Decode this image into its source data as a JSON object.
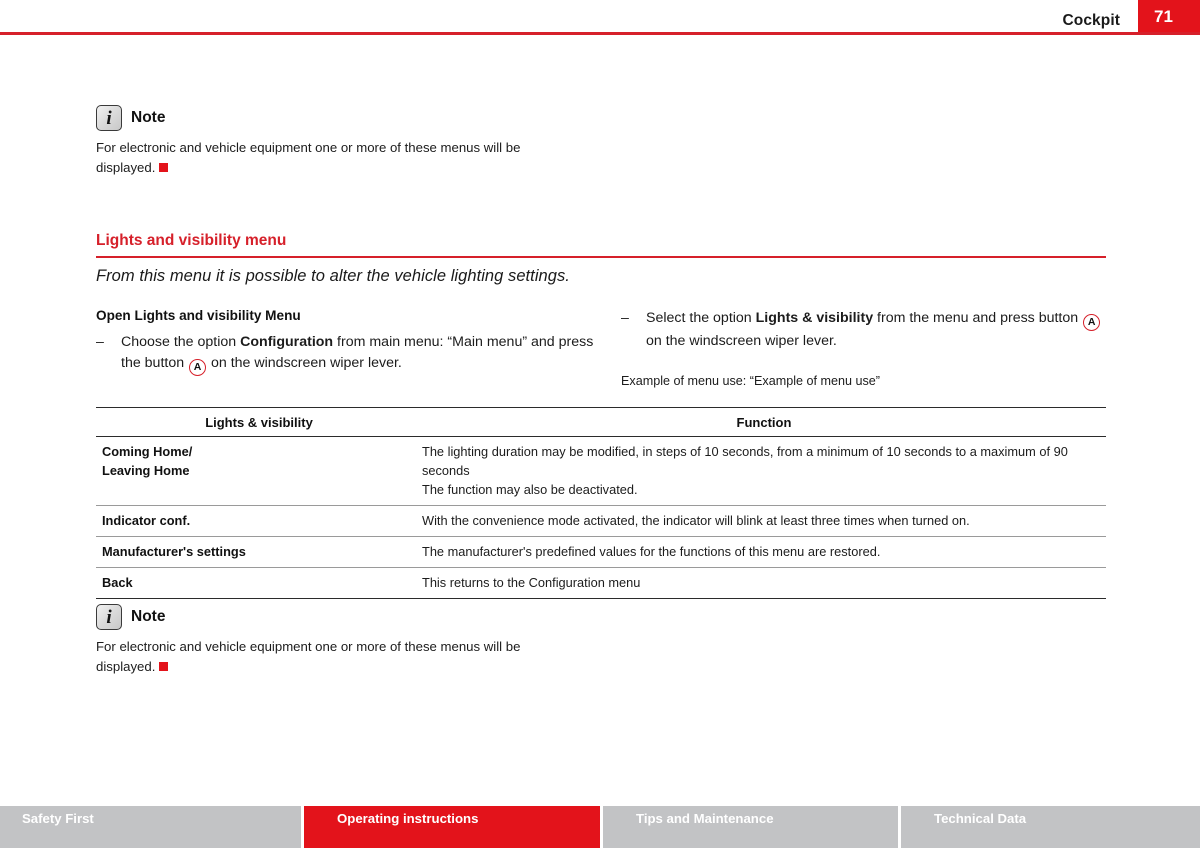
{
  "header": {
    "title": "Cockpit",
    "page_number": "71",
    "rule_color": "#d6202a",
    "page_box_color": "#e3131b"
  },
  "note_top": {
    "icon": "info-icon",
    "icon_glyph": "i",
    "label": "Note",
    "body": "For electronic and vehicle equipment one or more of these menus will be displayed.",
    "end_marker_color": "#e3131b"
  },
  "section": {
    "heading": "Lights and visibility menu",
    "heading_color": "#d6202a",
    "intro": "From this menu it is possible to alter the vehicle lighting settings."
  },
  "left_column": {
    "sub_heading": "Open Lights and visibility Menu",
    "bullet_dash": "–",
    "step_part1": "Choose the option ",
    "step_bold": "Configuration",
    "step_part2": " from main menu: “Main menu” and press the button ",
    "button_label": "A",
    "step_part3": " on the windscreen wiper lever."
  },
  "right_column": {
    "bullet_dash": "–",
    "step_part1": "Select the option ",
    "step_bold": "Lights & visibility",
    "step_part2": " from the menu and press button ",
    "button_label": "A",
    "step_part3": " on the windscreen wiper lever.",
    "example": "Example of menu use: “Example of menu use”"
  },
  "table": {
    "headers": [
      "Lights & visibility",
      "Function"
    ],
    "rows": [
      {
        "key": "Coming Home/\nLeaving Home",
        "value": "The lighting duration may be modified, in steps of 10 seconds, from a minimum of 10 seconds to a maximum of 90 seconds\nThe function may also be deactivated."
      },
      {
        "key": "Indicator conf.",
        "value": "With the convenience mode activated, the indicator will blink at least three times when turned on."
      },
      {
        "key": "Manufacturer's settings",
        "value": "The manufacturer's predefined values for the functions of this menu are restored."
      },
      {
        "key": "Back",
        "value": "This returns to the Configuration menu"
      }
    ]
  },
  "note_bottom": {
    "icon": "info-icon",
    "icon_glyph": "i",
    "label": "Note",
    "body": "For electronic and vehicle equipment one or more of these menus will be displayed.",
    "end_marker_color": "#e3131b"
  },
  "footer": {
    "tabs": [
      {
        "label": "Safety First",
        "active": false
      },
      {
        "label": "Operating instructions",
        "active": true
      },
      {
        "label": "Tips and Maintenance",
        "active": false
      },
      {
        "label": "Technical Data",
        "active": false
      }
    ],
    "active_color": "#e3131b",
    "inactive_color": "#c2c3c5"
  }
}
